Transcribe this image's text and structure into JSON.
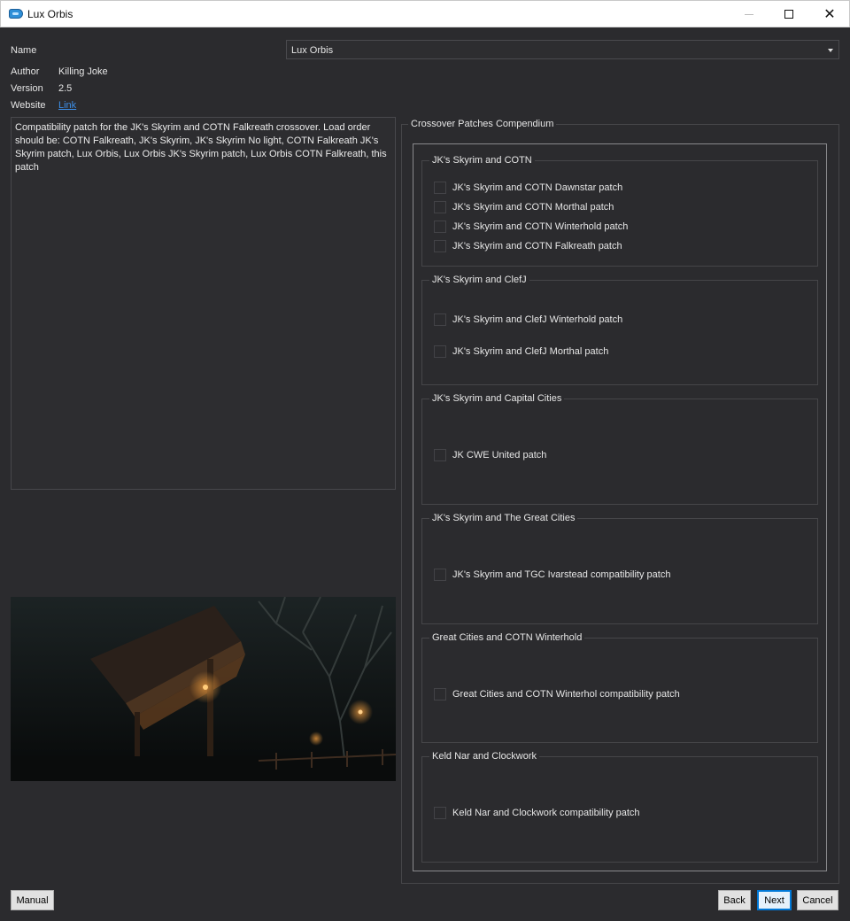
{
  "window": {
    "title": "Lux Orbis",
    "close_glyph": "✕"
  },
  "info": {
    "name_label": "Name",
    "name_value": "Lux Orbis",
    "author_label": "Author",
    "author_value": "Killing Joke",
    "version_label": "Version",
    "version_value": "2.5",
    "website_label": "Website",
    "website_link": "Link"
  },
  "description": "Compatibility patch for the JK's Skyrim and COTN Falkreath crossover. Load order should be: COTN Falkreath, JK's Skyrim, JK's Skyrim No light, COTN Falkreath JK's Skyrim patch, Lux Orbis, Lux Orbis JK's Skyrim patch, Lux Orbis COTN Falkreath, this patch",
  "compendium": {
    "title": "Crossover Patches Compendium",
    "groups": [
      {
        "title": "JK's Skyrim and COTN",
        "options": [
          "JK's Skyrim and COTN Dawnstar patch",
          "JK's Skyrim and COTN Morthal patch",
          "JK's Skyrim and COTN Winterhold patch",
          "JK's Skyrim and COTN Falkreath patch"
        ]
      },
      {
        "title": "JK's Skyrim and ClefJ",
        "options": [
          "JK's Skyrim and ClefJ Winterhold patch",
          "JK's Skyrim and ClefJ Morthal patch"
        ]
      },
      {
        "title": "JK's Skyrim and Capital Cities",
        "options": [
          "JK CWE United patch"
        ]
      },
      {
        "title": "JK's Skyrim and The Great Cities",
        "options": [
          "JK's Skyrim and TGC Ivarstead compatibility patch"
        ]
      },
      {
        "title": "Great Cities and COTN Winterhold",
        "options": [
          "Great Cities and COTN Winterhol compatibility patch"
        ]
      },
      {
        "title": "Keld Nar and Clockwork",
        "options": [
          "Keld Nar and Clockwork compatibility patch"
        ]
      }
    ]
  },
  "buttons": {
    "manual": "Manual",
    "back": "Back",
    "next": "Next",
    "cancel": "Cancel"
  },
  "icons": {
    "app": "app-logo-icon",
    "preview": "preview-image"
  }
}
